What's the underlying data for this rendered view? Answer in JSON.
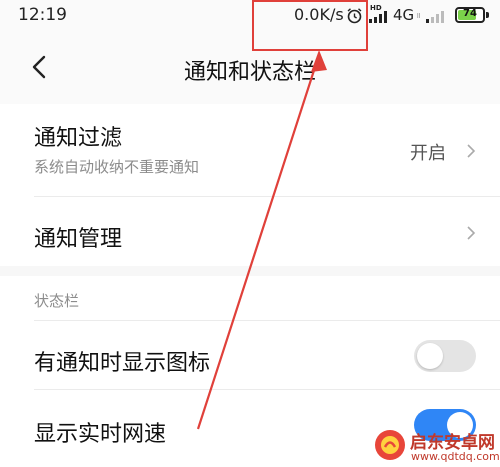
{
  "status_bar": {
    "time": "12:19",
    "net_speed": "0.0K/s",
    "hd": "HD",
    "network": "4G",
    "network_sub": "ll",
    "battery": "74",
    "battery_level": 0.74
  },
  "header": {
    "title": "通知和状态栏"
  },
  "notifications": {
    "filter": {
      "title": "通知过滤",
      "subtitle": "系统自动收纳不重要通知",
      "value": "开启"
    },
    "manage": {
      "title": "通知管理"
    }
  },
  "status_bar_section": {
    "label": "状态栏",
    "show_icons": {
      "title": "有通知时显示图标",
      "enabled": false
    },
    "show_speed": {
      "title": "显示实时网速",
      "enabled": true
    }
  },
  "watermark": {
    "name": "启东安卓网",
    "url": "www.qdtdq.com"
  },
  "colors": {
    "accent": "#2f86f6",
    "annotation": "#e0403a",
    "battery": "#7bd24a"
  }
}
